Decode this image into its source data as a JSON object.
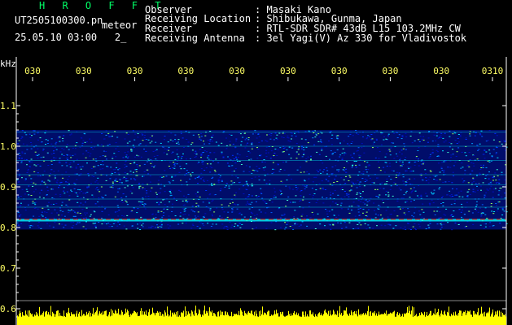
{
  "header": {
    "app_title": "H R O F F T",
    "file_name": "UT2505100300.pn",
    "mode_label": "meteor",
    "datetime": "25.05.10 03:00",
    "page_indicator": "2_",
    "info": [
      {
        "label": "Observer",
        "value": "Masaki Kano"
      },
      {
        "label": "Receiving Location",
        "value": "Shibukawa, Gunma, Japan"
      },
      {
        "label": "Receiver",
        "value": "RTL-SDR SDR# 43dB L15 103.2MHz CW"
      },
      {
        "label": "Receiving Antenna",
        "value": "3el Yagi(V) Az 330 for Vladivostok"
      }
    ]
  },
  "chart_data": {
    "type": "heatmap",
    "ylabel": "kHz",
    "yticks": [
      "1.1",
      "1.0",
      "0.9",
      "0.8",
      "0.7",
      "0.6"
    ],
    "ytick_values": [
      1.1,
      1.0,
      0.9,
      0.8,
      0.7,
      0.6
    ],
    "ylim": [
      0.6,
      1.1
    ],
    "xticks": [
      "030",
      "030",
      "030",
      "030",
      "030",
      "030",
      "030",
      "030",
      "030",
      "0310"
    ],
    "signal_band": [
      0.795,
      1.04
    ],
    "strong_line": 0.82,
    "colors": {
      "background": "#000000",
      "axis": "#ffffff",
      "tick_label": "#ffff66",
      "low": "#0000aa",
      "mid": "#00ffff",
      "high": "#ffff00",
      "peak": "#ff2200",
      "noise_bars": "#ffff00"
    }
  }
}
